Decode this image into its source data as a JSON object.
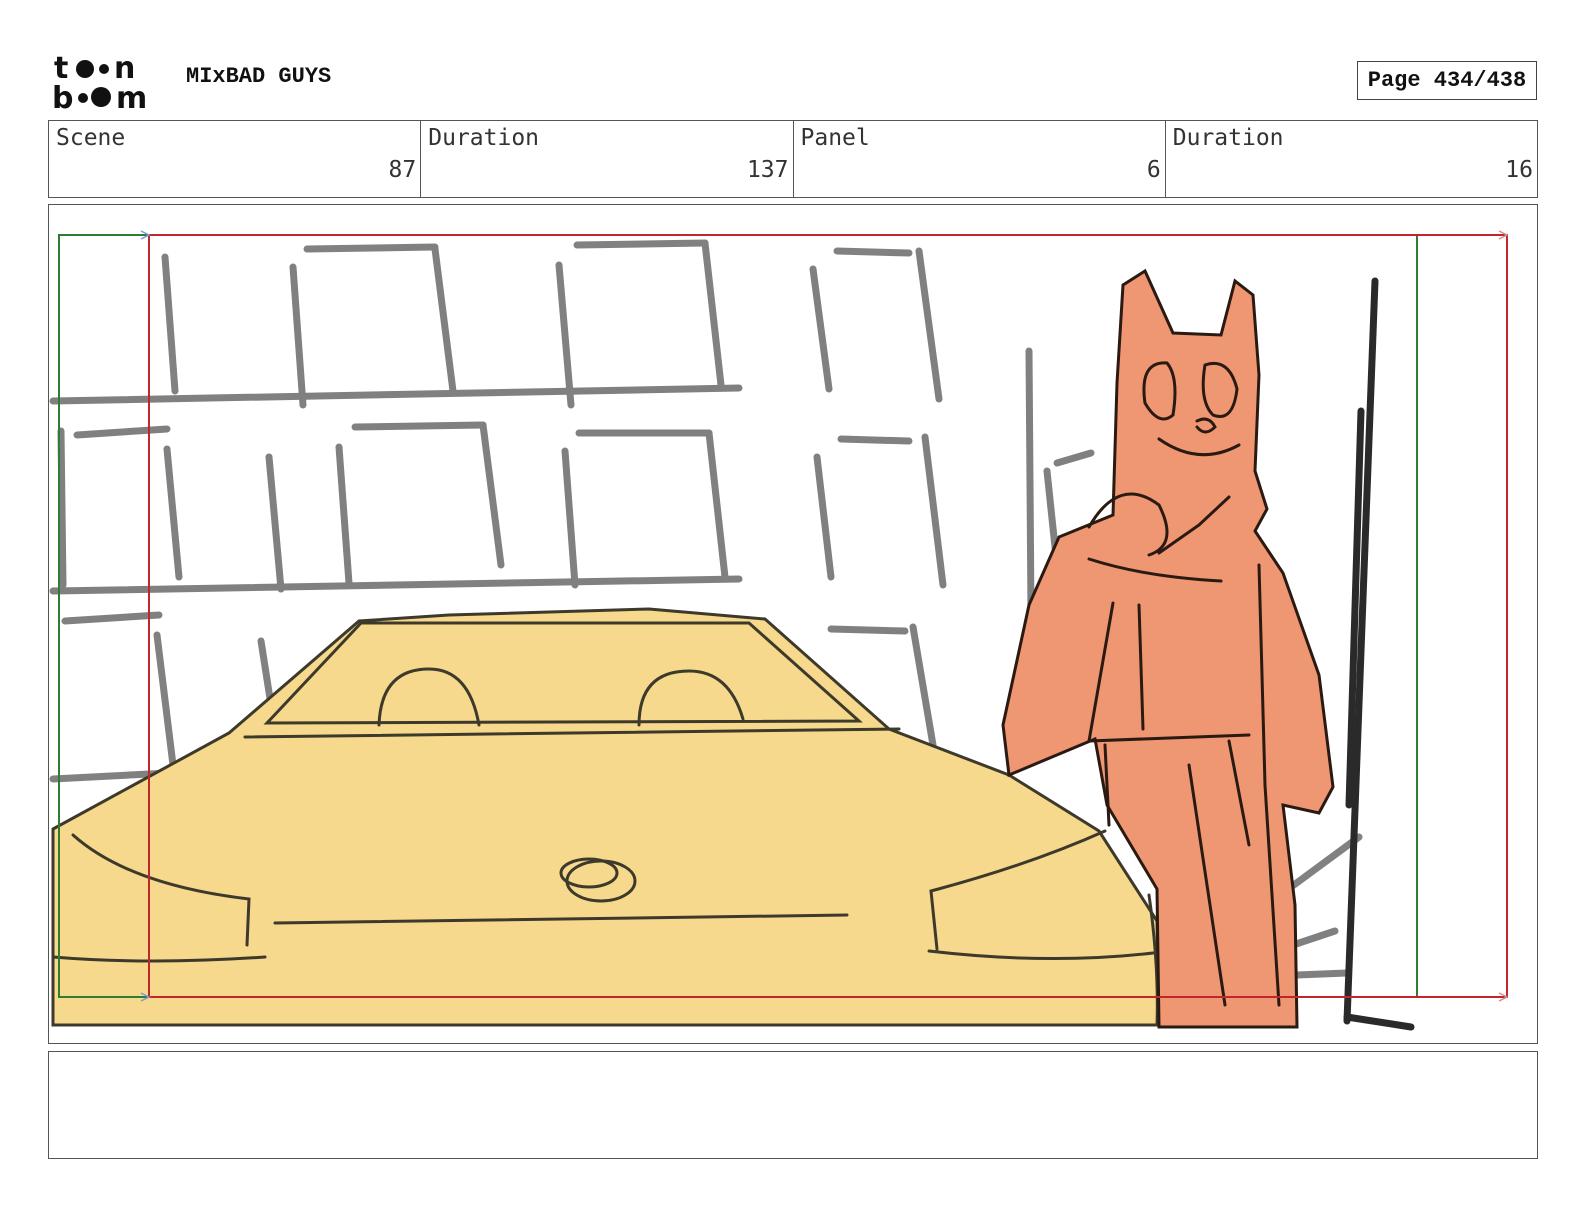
{
  "header": {
    "logo_alt": "toon boom",
    "project_title": "MIxBAD GUYS",
    "page_label": "Page 434/438"
  },
  "info": {
    "scene_label": "Scene",
    "scene_value": "87",
    "scene_duration_label": "Duration",
    "scene_duration_value": "137",
    "panel_label": "Panel",
    "panel_value": "6",
    "panel_duration_label": "Duration",
    "panel_duration_value": "16"
  },
  "colors": {
    "car_fill": "#f6d98c",
    "character_fill": "#ef9673",
    "safe_frame_red": "#c0262c",
    "camera_frame_green": "#2e7d32"
  },
  "notes": {
    "text": ""
  }
}
